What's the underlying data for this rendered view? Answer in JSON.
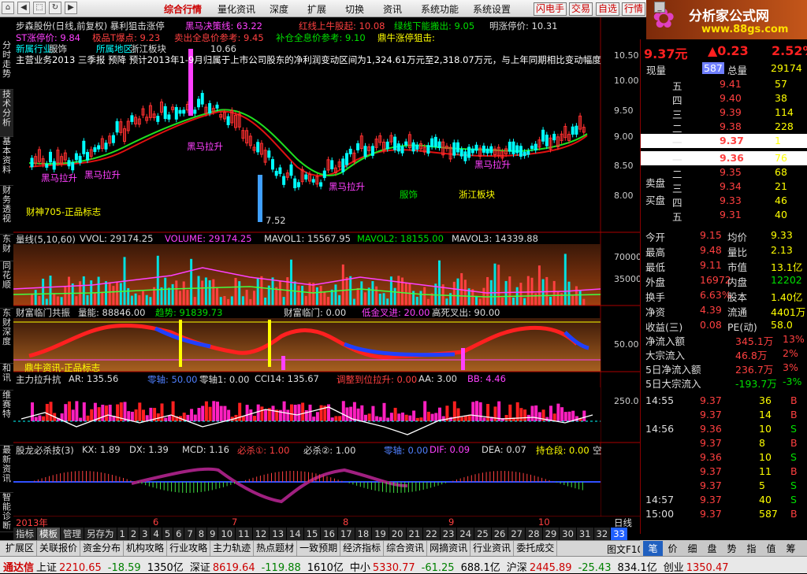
{
  "menu": {
    "items": [
      "综合行情",
      "量化资讯",
      "深度",
      "扩展",
      "切换",
      "资讯",
      "系统功能",
      "系统设置"
    ],
    "buttons": [
      "闪电手",
      "交易",
      "自选",
      "行情"
    ]
  },
  "logo": {
    "text": "分析家公式网",
    "url": "www.88gs.com"
  },
  "vtabs": [
    "分时走势",
    "技术分析",
    "基本资料",
    "财务透视",
    "东财",
    "同花顺",
    "东财深度",
    "和讯",
    "维赛特",
    "最新资讯",
    "智能诊断"
  ],
  "main": {
    "title": "步森股份(日线,前复权) 暴利狙击涨停",
    "line1": {
      "a": "黑马决策线: 63.22",
      "b": "红线上牛股起: 10.08",
      "c": "绿线下能搬出: 9.05",
      "d": "明涨停价: 10.31"
    },
    "line2": {
      "a": "ST涨停价: 9.84",
      "b": "极品T爆点: 9.23",
      "c": "卖出全息价参考: 9.45",
      "d": "补仓全息价参考: 9.10",
      "e": "鼎牛涨停狙击:"
    },
    "line3": {
      "a": "新属行业:",
      "b": "服饰",
      "c": "所属地区:",
      "d": "浙江板块"
    },
    "news": "主营业务2013 三季报 预降 预计2013年1-9月归属于上市公司股东的净利润变动区间为1,324.61万元至2,318.07万元，与上年同期相比变动幅度",
    "labels": {
      "hm1": "黑马拉升",
      "hm2": "黑马拉升",
      "hm3": "黑马拉升",
      "hm4": "黑马拉升",
      "hm5": "黑马拉升",
      "sector1": "服饰",
      "sector2": "浙江板块",
      "caishen": "财神705-正品标志",
      "low": "7.52",
      "high": "10.66"
    },
    "yaxis": [
      "10.50",
      "10.00",
      "9.50",
      "9.00",
      "8.50",
      "8.00"
    ]
  },
  "vol": {
    "title": "量线(5,10,60)",
    "a": "VVOL: 29174.25",
    "b": "VOLUME: 29174.25",
    "c": "MAVOL1: 15567.95",
    "d": "MAVOL2: 18155.00",
    "e": "MAVOL3: 14339.88",
    "yaxis": [
      "70000",
      "35000"
    ]
  },
  "ind1": {
    "title": "财富临门共振",
    "a": "量能: 88846.00",
    "b": "趋势: 91839.73",
    "c": "财富临门: 0.00",
    "d": "低金叉进: 20.00",
    "e": "高死叉出: 90.00",
    "y": "50.00",
    "mark1": "鼎牛资讯-正品标志",
    "mark2": "财富临门"
  },
  "ind2": {
    "title": "主力拉升抗",
    "a": "AR: 135.56",
    "b": "零轴: 50.00",
    "c": "零轴1: 0.00",
    "d": "CCI14: 135.67",
    "e": "调整到位拉升: 0.00",
    "f": "AA: 3.00",
    "g": "BB: 4.46",
    "y": "250.0"
  },
  "ind3": {
    "title": "股龙必杀技(3)",
    "a": "KX: 1.89",
    "b": "DX: 1.39",
    "c": "MCD: 1.16",
    "d": "必杀①: 1.00",
    "e": "必杀②: 1.00",
    "f": "零轴: 0.00",
    "g": "DIF: 0.09",
    "h": "DEA: 0.07",
    "i": "持仓段: 0.00",
    "j": "空"
  },
  "timebar": {
    "year": "2013年",
    "m6": "6",
    "m7": "7",
    "m8": "8",
    "m9": "9",
    "m10": "10",
    "daily": "日线"
  },
  "periods": [
    "指标",
    "模板",
    "管理",
    "另存为",
    "1",
    "2",
    "3",
    "4",
    "5",
    "6",
    "7",
    "8",
    "9",
    "10",
    "11",
    "12",
    "13",
    "14",
    "15",
    "16",
    "17",
    "18",
    "19",
    "20",
    "21",
    "22",
    "23",
    "24",
    "25",
    "26",
    "27",
    "28",
    "29",
    "30",
    "31",
    "32",
    "33"
  ],
  "quote": {
    "price": "9.37元",
    "change": "▲0.23",
    "pct": "2.52%",
    "xianliang_label": "现量",
    "xianliang": "587",
    "zongliang_label": "总量",
    "zongliang": "29174",
    "sells": [
      [
        "五",
        "9.41",
        "57"
      ],
      [
        "四",
        "9.40",
        "38"
      ],
      [
        "三",
        "9.39",
        "114"
      ],
      [
        "二",
        "9.38",
        "228"
      ],
      [
        "一",
        "9.37",
        "1"
      ]
    ],
    "buys": [
      [
        "一",
        "9.36",
        "76"
      ],
      [
        "二",
        "9.35",
        "68"
      ],
      [
        "三",
        "9.34",
        "21"
      ],
      [
        "四",
        "9.33",
        "46"
      ],
      [
        "五",
        "9.31",
        "40"
      ]
    ],
    "sell_label": "卖盘",
    "buy_label": "买盘",
    "stats": [
      [
        "今开",
        "9.15",
        "均价",
        "9.33"
      ],
      [
        "最高",
        "9.48",
        "量比",
        "2.13"
      ],
      [
        "最低",
        "9.11",
        "市值",
        "13.1亿"
      ],
      [
        "外盘",
        "16972",
        "内盘",
        "12202"
      ],
      [
        "换手",
        "6.63%",
        "股本",
        "1.40亿"
      ],
      [
        "净资",
        "4.39",
        "流通",
        "4401万"
      ],
      [
        "收益(三)",
        "0.08",
        "PE(动)",
        "58.0"
      ]
    ],
    "flows": [
      [
        "净流入额",
        "345.1万",
        "13%"
      ],
      [
        "大宗流入",
        "46.8万",
        "2%"
      ],
      [
        "5日净流入额",
        "236.7万",
        "3%"
      ],
      [
        "5日大宗流入",
        "-193.7万",
        "-3%"
      ]
    ],
    "ticks": [
      [
        "14:55",
        "9.37",
        "36",
        "B"
      ],
      [
        "",
        "9.37",
        "14",
        "B"
      ],
      [
        "14:56",
        "9.36",
        "10",
        "S"
      ],
      [
        "",
        "9.37",
        "8",
        "B"
      ],
      [
        "",
        "9.36",
        "10",
        "S"
      ],
      [
        "",
        "9.37",
        "11",
        "B"
      ],
      [
        "",
        "9.37",
        "5",
        "S"
      ],
      [
        "14:57",
        "9.37",
        "40",
        "S"
      ],
      [
        "15:00",
        "9.37",
        "587",
        "B"
      ]
    ]
  },
  "bottomtabs": [
    "扩展区",
    "关联报价",
    "资金分布",
    "机构攻略",
    "行业攻略",
    "主力轨迹",
    "热点题材",
    "一致预期",
    "经济指标",
    "综合资讯",
    "网摘资讯",
    "行业资讯",
    "委托成交"
  ],
  "bottomtabs_right": "图文F10",
  "rtabs": [
    "笔",
    "价",
    "细",
    "盘",
    "势",
    "指",
    "值",
    "筹"
  ],
  "status": [
    [
      "通达信",
      ""
    ],
    [
      "上证",
      "2210.65"
    ],
    [
      "",
      "-18.59"
    ],
    [
      "",
      "1350亿"
    ],
    [
      "深证",
      "8619.64"
    ],
    [
      "",
      "-119.88"
    ],
    [
      "",
      "1610亿"
    ],
    [
      "中小",
      "5330.77"
    ],
    [
      "",
      "-61.25"
    ],
    [
      "",
      "688.1亿"
    ],
    [
      "沪深",
      "2445.89"
    ],
    [
      "",
      "-25.43"
    ],
    [
      "",
      "834.1亿"
    ],
    [
      "创业",
      "1350.47"
    ]
  ]
}
